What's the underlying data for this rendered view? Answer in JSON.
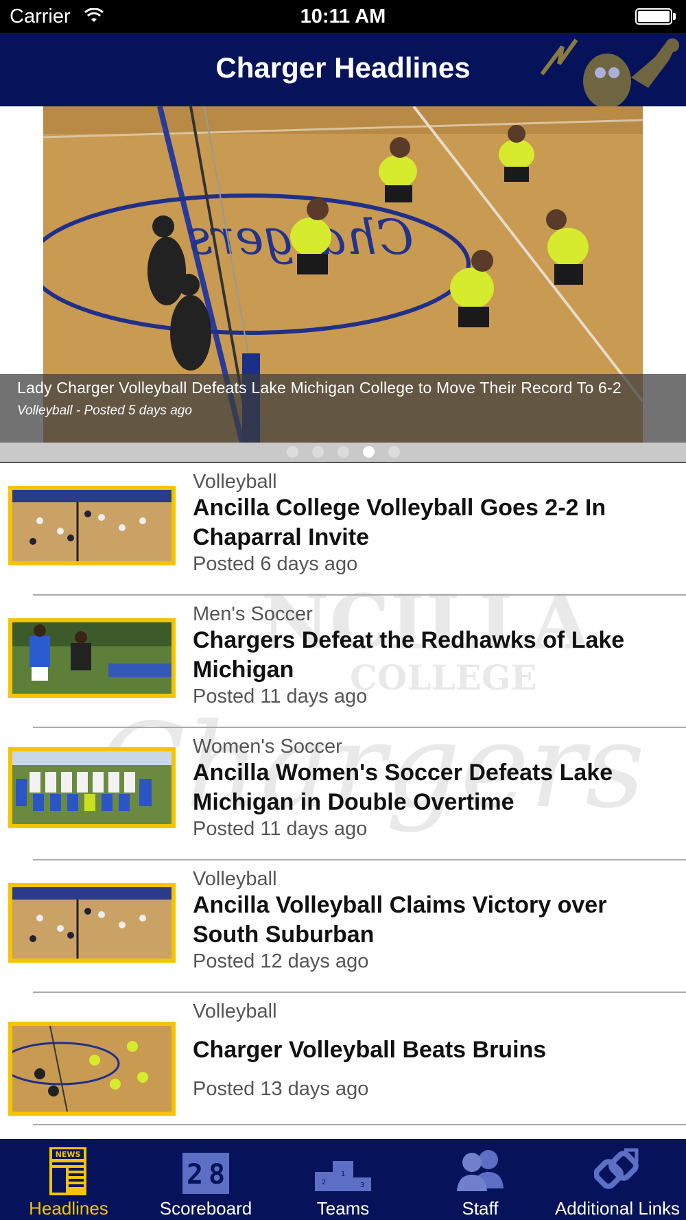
{
  "status_bar": {
    "carrier": "Carrier",
    "time": "10:11 AM"
  },
  "nav": {
    "title": "Charger Headlines"
  },
  "hero": {
    "title": "Lady Charger Volleyball Defeats Lake Michigan College to Move Their Record To 6-2",
    "meta": "Volleyball - Posted 5 days ago",
    "page_count": 5,
    "active_page": 4
  },
  "news": [
    {
      "category": "Volleyball",
      "title": "Ancilla College Volleyball Goes 2-2 In Chaparral Invite",
      "date": "Posted 6 days ago"
    },
    {
      "category": "Men's Soccer",
      "title": "Chargers Defeat the Redhawks of Lake Michigan",
      "date": "Posted 11 days ago"
    },
    {
      "category": "Women's Soccer",
      "title": "Ancilla Women's Soccer Defeats Lake Michigan in Double Overtime",
      "date": "Posted 11 days ago"
    },
    {
      "category": "Volleyball",
      "title": "Ancilla Volleyball Claims Victory over South Suburban",
      "date": "Posted 12 days ago"
    },
    {
      "category": "Volleyball",
      "title": "Charger Volleyball Beats Bruins",
      "date": "Posted 13 days ago"
    }
  ],
  "tabs": [
    {
      "label": "Headlines",
      "icon": "news-icon",
      "active": true
    },
    {
      "label": "Scoreboard",
      "icon": "scoreboard-icon",
      "active": false
    },
    {
      "label": "Teams",
      "icon": "podium-icon",
      "active": false
    },
    {
      "label": "Staff",
      "icon": "people-icon",
      "active": false
    },
    {
      "label": "Additional Links",
      "icon": "link-icon",
      "active": false
    }
  ],
  "colors": {
    "nav": "#06135a",
    "accent": "#f5c400",
    "thumb_border": "#f5c400"
  }
}
